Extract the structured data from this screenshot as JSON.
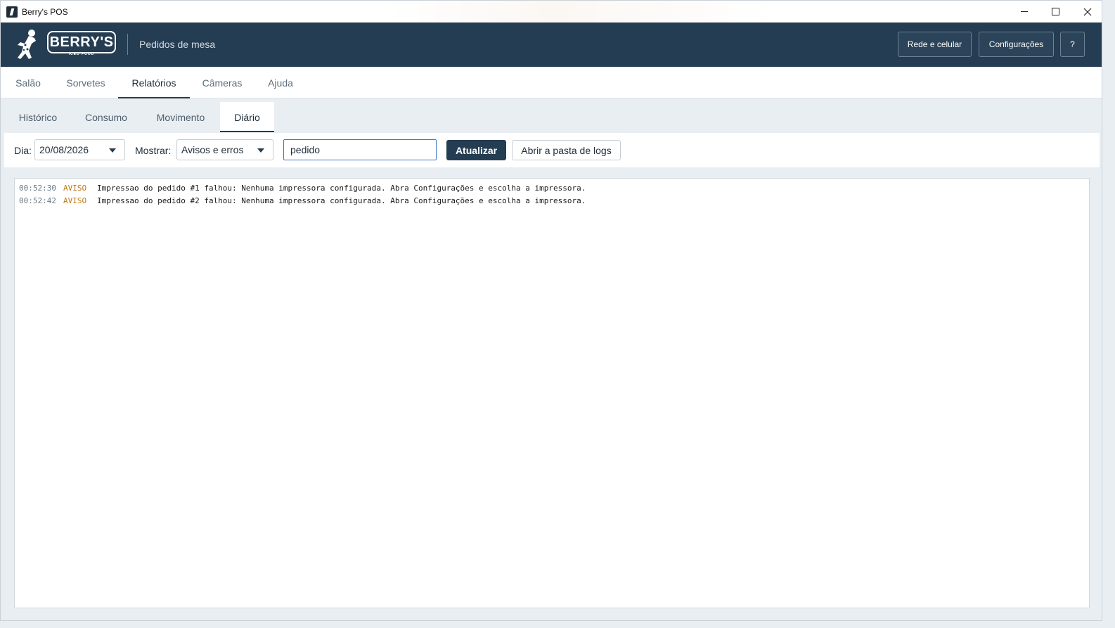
{
  "window": {
    "title": "Berry's POS"
  },
  "header": {
    "logo_text": "BERRY'S",
    "logo_subtext": "ICED FOOD",
    "subtitle": "Pedidos de mesa",
    "buttons": {
      "network": "Rede e celular",
      "settings": "Configurações",
      "help": "?"
    }
  },
  "main_tabs": [
    {
      "label": "Salão"
    },
    {
      "label": "Sorvetes"
    },
    {
      "label": "Relatórios"
    },
    {
      "label": "Câmeras"
    },
    {
      "label": "Ajuda"
    }
  ],
  "main_tab_active": "Relatórios",
  "sub_tabs": [
    {
      "label": "Histórico"
    },
    {
      "label": "Consumo"
    },
    {
      "label": "Movimento"
    },
    {
      "label": "Diário"
    }
  ],
  "sub_tab_active": "Diário",
  "toolbar": {
    "day_label": "Dia:",
    "day_value": "20/08/2026",
    "show_label": "Mostrar:",
    "show_value": "Avisos e erros",
    "search_value": "pedido",
    "refresh_button": "Atualizar",
    "open_logs_button": "Abrir a pasta de logs"
  },
  "log": {
    "entries": [
      {
        "time": "00:52:30",
        "level": "AVISO",
        "message": "Impressao do pedido #1 falhou: Nenhuma impressora configurada. Abra Configurações e escolha a impressora."
      },
      {
        "time": "00:52:42",
        "level": "AVISO",
        "message": "Impressao do pedido #2 falhou: Nenhuma impressora configurada. Abra Configurações e escolha a impressora."
      }
    ]
  },
  "colors": {
    "header_bg": "#253d52",
    "accent": "#253d52",
    "warning": "#c07a1a",
    "focus_border": "#3a79c2"
  }
}
